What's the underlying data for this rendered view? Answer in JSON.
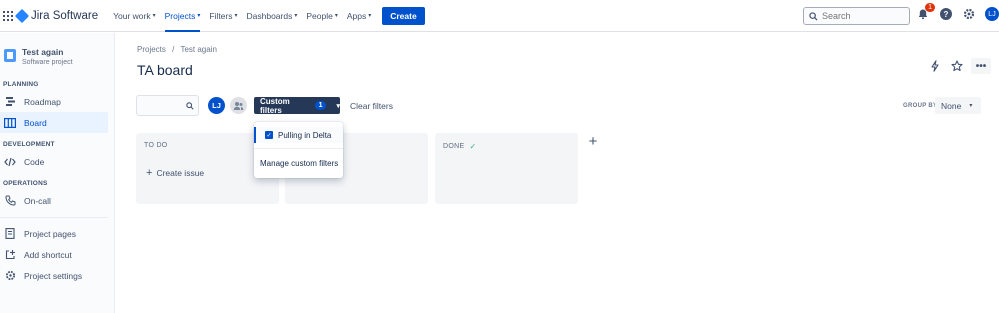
{
  "topnav": {
    "product": "Jira Software",
    "items": [
      {
        "label": "Your work",
        "active": false
      },
      {
        "label": "Projects",
        "active": true
      },
      {
        "label": "Filters",
        "active": false
      },
      {
        "label": "Dashboards",
        "active": false
      },
      {
        "label": "People",
        "active": false
      },
      {
        "label": "Apps",
        "active": false
      }
    ],
    "create_label": "Create",
    "search_placeholder": "Search",
    "notification_count": "1",
    "help_glyph": "?",
    "user_initials": "LJ",
    "accent": "#0052cc"
  },
  "sidebar": {
    "project_name": "Test again",
    "project_type": "Software project",
    "sections": {
      "planning": "PLANNING",
      "development": "DEVELOPMENT",
      "operations": "OPERATIONS"
    },
    "items": {
      "roadmap": "Roadmap",
      "board": "Board",
      "code": "Code",
      "oncall": "On-call",
      "project_pages": "Project pages",
      "add_shortcut": "Add shortcut",
      "project_settings": "Project settings"
    }
  },
  "main": {
    "breadcrumb": {
      "root": "Projects",
      "sep": "/",
      "current": "Test again"
    },
    "title": "TA board",
    "more_glyph": "•••",
    "avatar_initials": "LJ",
    "custom_filters": {
      "label": "Custom filters",
      "count": "1"
    },
    "clear_filters": "Clear filters",
    "group_by_label": "GROUP BY",
    "group_by_value": "None",
    "columns": {
      "todo": "TO DO",
      "done": "DONE"
    },
    "create_issue": "Create issue"
  },
  "dropdown": {
    "option": "Pulling in Delta",
    "option_checked": true,
    "manage": "Manage custom filters"
  }
}
